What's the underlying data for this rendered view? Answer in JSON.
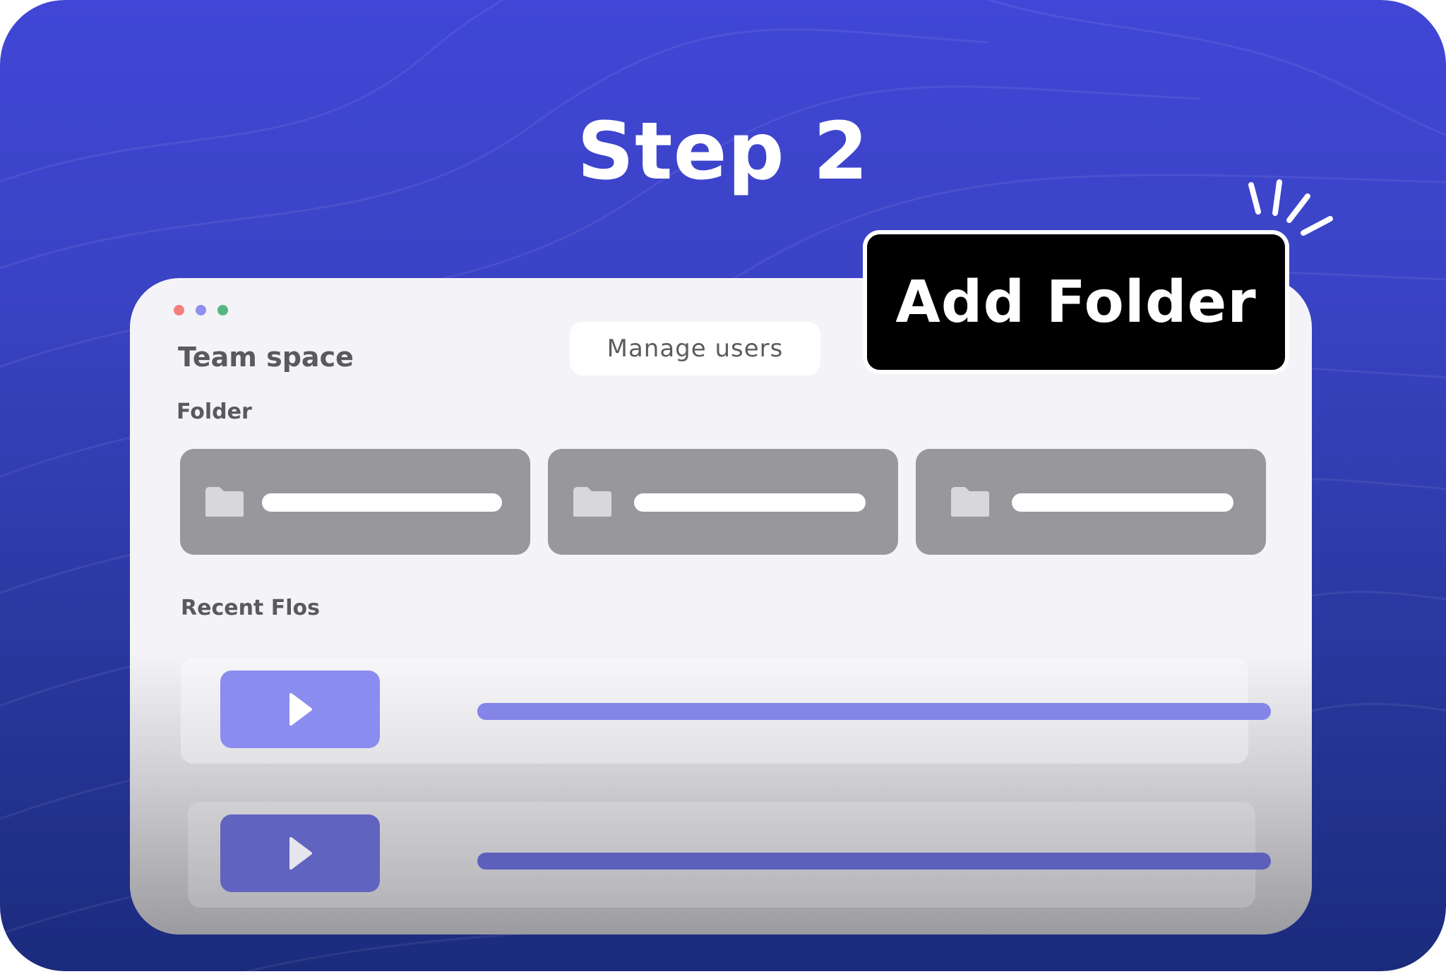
{
  "header": {
    "step_title": "Step 2"
  },
  "window": {
    "title": "Team space",
    "manage_users_label": "Manage users",
    "folder_section_label": "Folder",
    "recent_section_label": "Recent Flos",
    "folder_icon": "folder-icon",
    "play_icon": "play-icon",
    "traffic_lights": [
      "#f47f7f",
      "#8e90f0",
      "#55b783"
    ]
  },
  "callout": {
    "add_folder_label": "Add Folder"
  },
  "colors": {
    "background_top": "#4146d6",
    "background_bottom": "#1b2b7c",
    "window_bg": "#f4f3f7",
    "folder_tile": "#98979c",
    "flo_accent": "#8a8cef",
    "flo_accent_dim": "#6063c0",
    "callout_bg": "#000000"
  }
}
